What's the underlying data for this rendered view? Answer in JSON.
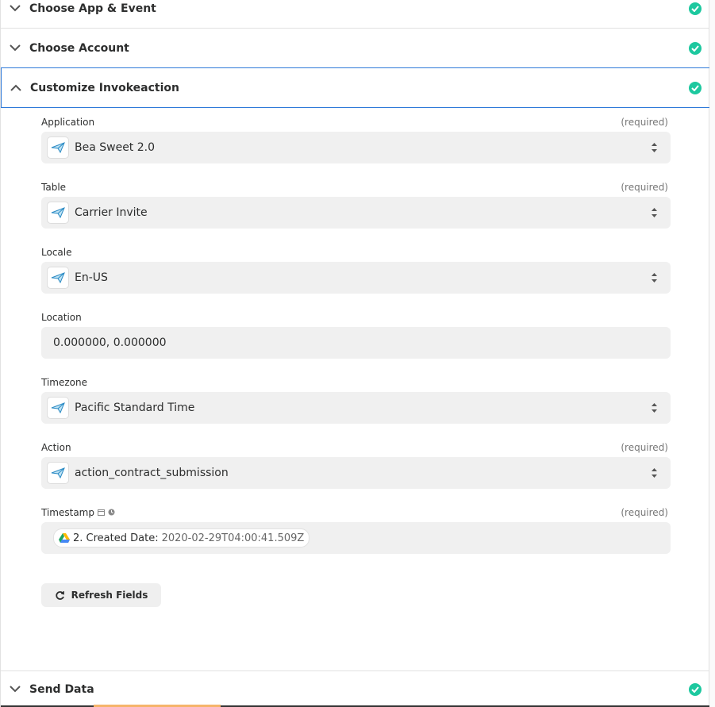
{
  "sections": {
    "choose_app": {
      "title": "Choose App & Event"
    },
    "choose_account": {
      "title": "Choose Account"
    },
    "customize": {
      "title": "Customize Invokeaction"
    },
    "send_data": {
      "title": "Send Data"
    }
  },
  "fields": {
    "application": {
      "label": "Application",
      "required": "(required)",
      "value": "Bea Sweet 2.0"
    },
    "table": {
      "label": "Table",
      "required": "(required)",
      "value": "Carrier Invite"
    },
    "locale": {
      "label": "Locale",
      "value": "En-US"
    },
    "location": {
      "label": "Location",
      "value": "0.000000, 0.000000"
    },
    "timezone": {
      "label": "Timezone",
      "value": "Pacific Standard Time"
    },
    "action": {
      "label": "Action",
      "required": "(required)",
      "value": "action_contract_submission"
    },
    "timestamp": {
      "label": "Timestamp",
      "required": "(required)",
      "pill_label": "2. Created Date:",
      "pill_value": "2020-02-29T04:00:41.509Z",
      "icons": [
        "calendar-icon",
        "clock-icon"
      ]
    }
  },
  "refresh": {
    "label": "Refresh Fields"
  },
  "colors": {
    "accent_check": "#1dc89f",
    "active_border": "#2f7ad9",
    "field_bg": "#f0f0f0"
  }
}
